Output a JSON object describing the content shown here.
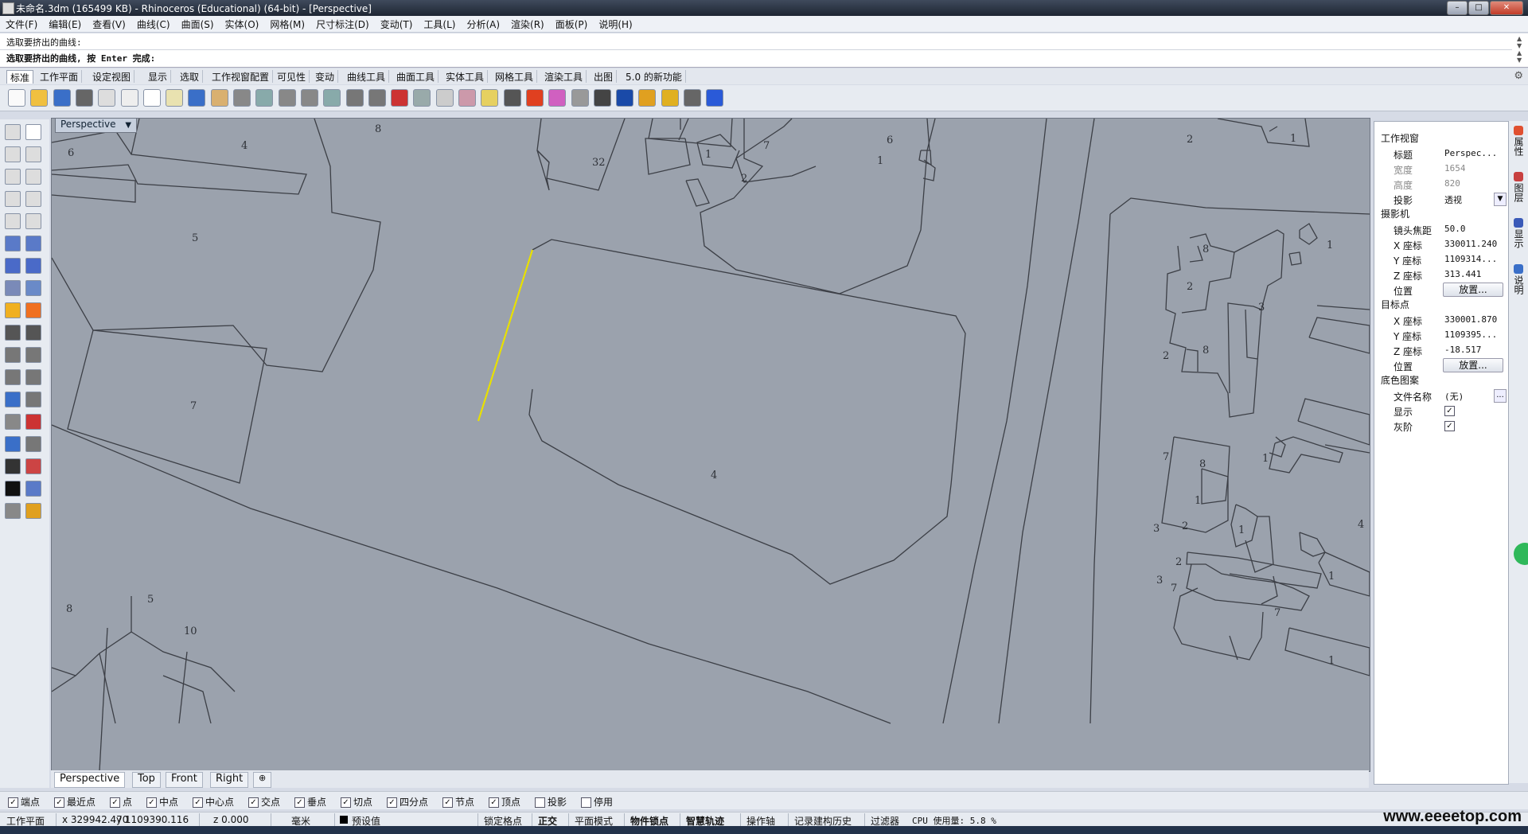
{
  "window": {
    "title": "未命名.3dm (165499 KB) - Rhinoceros (Educational) (64-bit) - [Perspective]"
  },
  "menu": [
    "文件(F)",
    "编辑(E)",
    "查看(V)",
    "曲线(C)",
    "曲面(S)",
    "实体(O)",
    "网格(M)",
    "尺寸标注(D)",
    "变动(T)",
    "工具(L)",
    "分析(A)",
    "渲染(R)",
    "面板(P)",
    "说明(H)"
  ],
  "command": {
    "history": "选取要挤出的曲线:",
    "prompt": "选取要挤出的曲线, 按 Enter 完成:"
  },
  "toolbar_tabs": [
    "标准",
    "工作平面",
    "设定视图",
    "显示",
    "选取",
    "工作视窗配置",
    "可见性",
    "变动",
    "曲线工具",
    "曲面工具",
    "实体工具",
    "网格工具",
    "渲染工具",
    "出图",
    "5.0 的新功能"
  ],
  "viewport": {
    "label": "Perspective",
    "tabs": [
      "Perspective",
      "Top",
      "Front",
      "Right"
    ]
  },
  "parcels": [
    "8",
    "4",
    "6",
    "5",
    "32",
    "1",
    "7",
    "2",
    "6",
    "1",
    "7",
    "4",
    "2",
    "8",
    "2",
    "3",
    "1",
    "1",
    "8",
    "2",
    "7",
    "8",
    "7",
    "1",
    "1",
    "2",
    "3",
    "2",
    "3",
    "1",
    "1",
    "7",
    "1",
    "4",
    "5",
    "8",
    "10"
  ],
  "panel": {
    "section_viewport": "工作视窗",
    "rows_viewport": [
      {
        "label": "标题",
        "value": "Perspec..."
      },
      {
        "label": "宽度",
        "value": "1654"
      },
      {
        "label": "高度",
        "value": "820"
      },
      {
        "label": "投影",
        "value": "透视"
      }
    ],
    "section_camera": "摄影机",
    "rows_camera": [
      {
        "label": "镜头焦距",
        "value": "50.0"
      },
      {
        "label": "X 座标",
        "value": "330011.240"
      },
      {
        "label": "Y 座标",
        "value": "1109314..."
      },
      {
        "label": "Z 座标",
        "value": "313.441"
      },
      {
        "label": "位置",
        "value": "放置..."
      }
    ],
    "section_target": "目标点",
    "rows_target": [
      {
        "label": "X 座标",
        "value": "330001.870"
      },
      {
        "label": "Y 座标",
        "value": "1109395..."
      },
      {
        "label": "Z 座标",
        "value": "-18.517"
      },
      {
        "label": "位置",
        "value": "放置..."
      }
    ],
    "section_wallpaper": "底色图案",
    "rows_wallpaper": [
      {
        "label": "文件名称",
        "value": "(无)"
      },
      {
        "label": "显示",
        "value": "✓"
      },
      {
        "label": "灰阶",
        "value": "✓"
      }
    ],
    "side_tabs": [
      "属性",
      "图层",
      "显示",
      "说明"
    ]
  },
  "osnaps": [
    {
      "label": "端点",
      "checked": true
    },
    {
      "label": "最近点",
      "checked": true
    },
    {
      "label": "点",
      "checked": true
    },
    {
      "label": "中点",
      "checked": true
    },
    {
      "label": "中心点",
      "checked": true
    },
    {
      "label": "交点",
      "checked": true
    },
    {
      "label": "垂点",
      "checked": true
    },
    {
      "label": "切点",
      "checked": true
    },
    {
      "label": "四分点",
      "checked": true
    },
    {
      "label": "节点",
      "checked": true
    },
    {
      "label": "顶点",
      "checked": true
    },
    {
      "label": "投影",
      "checked": false
    },
    {
      "label": "停用",
      "checked": false
    }
  ],
  "status": {
    "cplane": "工作平面",
    "x": "x 329942.470",
    "y": "y 1109390.116",
    "z": "z 0.000",
    "units": "毫米",
    "layer": "预设值",
    "toggles": [
      "锁定格点",
      "正交",
      "平面模式",
      "物件锁点",
      "智慧轨迹",
      "操作轴",
      "记录建构历史",
      "过滤器"
    ],
    "cpu": "CPU 使用量: 5.8 %"
  },
  "watermark": "www.eeeetop.com",
  "colors": {
    "viewport_bg": "#9ba2ad",
    "selected_curve": "#e8e000",
    "line": "#3c3f46"
  }
}
